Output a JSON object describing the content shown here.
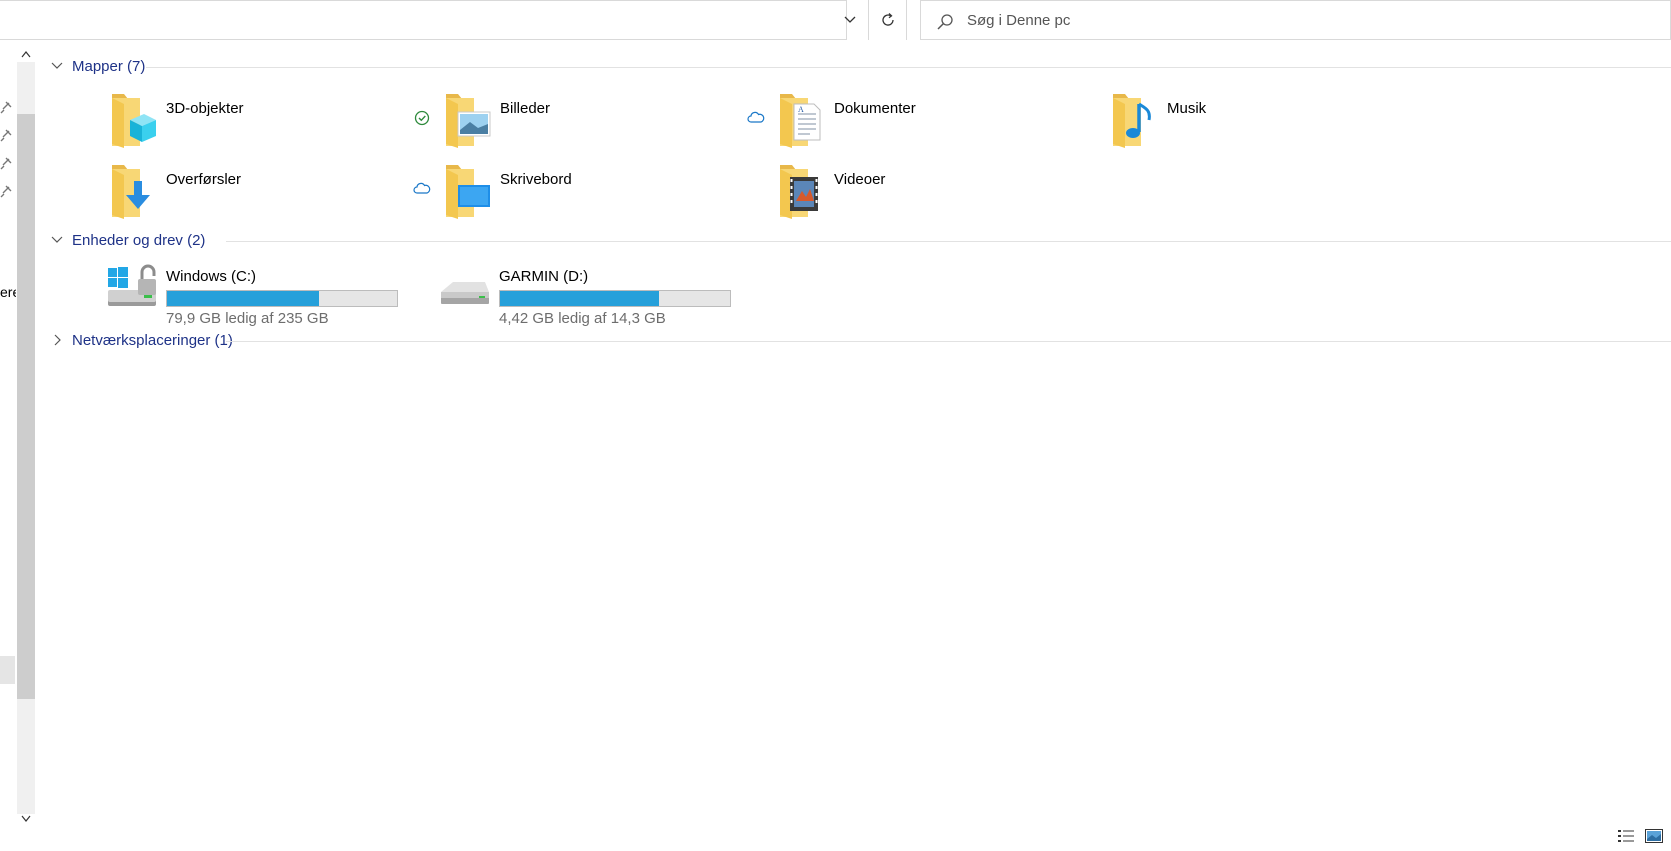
{
  "search": {
    "placeholder": "Søg i Denne pc"
  },
  "nav": {
    "cut_text": "ere"
  },
  "groups": [
    {
      "label": "Mapper (7)",
      "expanded": true
    },
    {
      "label": "Enheder og drev (2)",
      "expanded": true
    },
    {
      "label": "Netværksplaceringer (1)",
      "expanded": false
    }
  ],
  "folders": [
    {
      "name": "3D-objekter",
      "icon": "3d-objects-folder-icon",
      "status": "synced-check-icon"
    },
    {
      "name": "Billeder",
      "icon": "pictures-folder-icon",
      "status": "cloud-icon"
    },
    {
      "name": "Dokumenter",
      "icon": "documents-folder-icon",
      "status": ""
    },
    {
      "name": "Musik",
      "icon": "music-folder-icon",
      "status": ""
    },
    {
      "name": "Overførsler",
      "icon": "downloads-folder-icon",
      "status": "cloud-icon"
    },
    {
      "name": "Skrivebord",
      "icon": "desktop-folder-icon",
      "status": ""
    },
    {
      "name": "Videoer",
      "icon": "videos-folder-icon",
      "status": ""
    }
  ],
  "drives": [
    {
      "name": "Windows (C:)",
      "free": "79,9 GB ledig af 235 GB",
      "used_fraction": 0.66,
      "icon": "windows-drive-icon"
    },
    {
      "name": "GARMIN (D:)",
      "free": "4,42 GB ledig af 14,3 GB",
      "used_fraction": 0.69,
      "icon": "removable-drive-icon"
    }
  ],
  "colors": {
    "accent": "#26a0da",
    "group_header": "#1e3287",
    "folder": "#f8d775"
  }
}
